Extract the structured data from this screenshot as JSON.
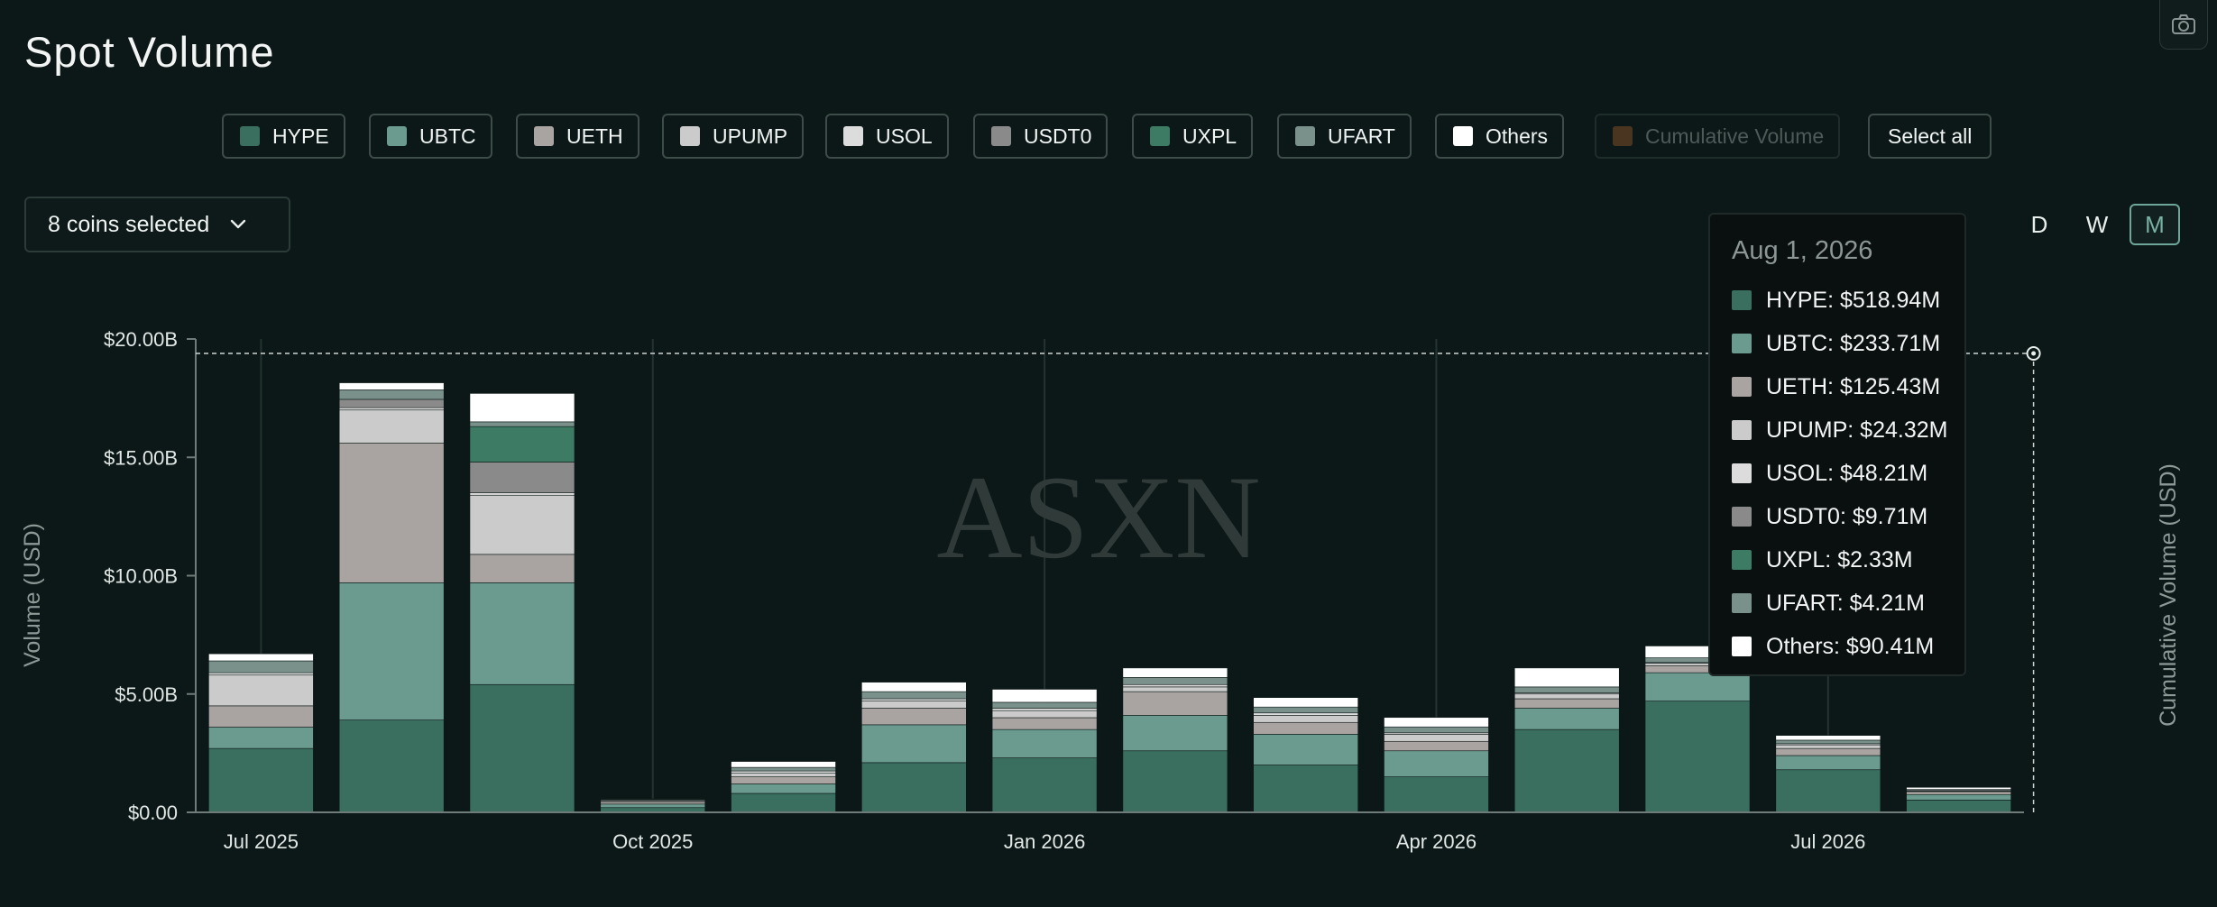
{
  "header": {
    "title": "Spot Volume"
  },
  "legend": [
    {
      "label": "HYPE",
      "color": "#3a6e5f",
      "active": true
    },
    {
      "label": "UBTC",
      "color": "#6b9a8f",
      "active": true
    },
    {
      "label": "UETH",
      "color": "#a9a3a1",
      "active": true
    },
    {
      "label": "UPUMP",
      "color": "#cbcbcb",
      "active": true
    },
    {
      "label": "USOL",
      "color": "#dcdcdc",
      "active": true
    },
    {
      "label": "USDT0",
      "color": "#8a8a8a",
      "active": true
    },
    {
      "label": "UXPL",
      "color": "#3e7b64",
      "active": true
    },
    {
      "label": "UFART",
      "color": "#7a918b",
      "active": true
    },
    {
      "label": "Others",
      "color": "#ffffff",
      "active": true
    },
    {
      "label": "Cumulative Volume",
      "color": "#5c4128",
      "active": false
    }
  ],
  "controls": {
    "select_all": "Select all",
    "coins_selected": "8 coins selected",
    "periods": [
      "D",
      "W",
      "M"
    ],
    "active_period": "M"
  },
  "watermark": "ASXN",
  "tooltip": {
    "date": "Aug 1, 2026",
    "rows": [
      {
        "label": "HYPE: $518.94M",
        "color": "#3a6e5f"
      },
      {
        "label": "UBTC: $233.71M",
        "color": "#6b9a8f"
      },
      {
        "label": "UETH: $125.43M",
        "color": "#a9a3a1"
      },
      {
        "label": "UPUMP: $24.32M",
        "color": "#cbcbcb"
      },
      {
        "label": "USOL: $48.21M",
        "color": "#dcdcdc"
      },
      {
        "label": "USDT0: $9.71M",
        "color": "#8a8a8a"
      },
      {
        "label": "UXPL: $2.33M",
        "color": "#3e7b64"
      },
      {
        "label": "UFART: $4.21M",
        "color": "#7a918b"
      },
      {
        "label": "Others: $90.41M",
        "color": "#ffffff"
      }
    ]
  },
  "chart_data": {
    "type": "bar",
    "stacked": true,
    "ylabel": "Volume (USD)",
    "y2label": "Cumulative Volume (USD)",
    "ylim": [
      0,
      20000000000
    ],
    "yticks": [
      "$0.00",
      "$5.00B",
      "$10.00B",
      "$15.00B",
      "$20.00B"
    ],
    "yticks_values": [
      0,
      5000000000,
      10000000000,
      15000000000,
      20000000000
    ],
    "categories": [
      "2025-07",
      "2025-08",
      "2025-09",
      "2025-10",
      "2025-11",
      "2025-12",
      "2026-01",
      "2026-02",
      "2026-03",
      "2026-04",
      "2026-05",
      "2026-06",
      "2026-07",
      "2026-08"
    ],
    "xticks": [
      {
        "label": "Jul 2025",
        "index": 0
      },
      {
        "label": "Oct 2025",
        "index": 3
      },
      {
        "label": "Jan 2026",
        "index": 6
      },
      {
        "label": "Apr 2026",
        "index": 9
      },
      {
        "label": "Jul 2026",
        "index": 12
      }
    ],
    "series": [
      {
        "name": "HYPE",
        "color": "#3a6e5f",
        "values": [
          2700000000,
          3900000000,
          5400000000,
          200000000,
          800000000,
          2100000000,
          2300000000,
          2600000000,
          2000000000,
          1500000000,
          3500000000,
          4700000000,
          1800000000,
          518940000
        ]
      },
      {
        "name": "UBTC",
        "color": "#6b9a8f",
        "values": [
          900000000,
          5800000000,
          4300000000,
          150000000,
          400000000,
          1600000000,
          1200000000,
          1500000000,
          1300000000,
          1100000000,
          900000000,
          1200000000,
          600000000,
          233710000
        ]
      },
      {
        "name": "UETH",
        "color": "#a9a3a1",
        "values": [
          900000000,
          5900000000,
          1200000000,
          100000000,
          300000000,
          700000000,
          500000000,
          1000000000,
          500000000,
          400000000,
          400000000,
          300000000,
          300000000,
          125430000
        ]
      },
      {
        "name": "UPUMP",
        "color": "#cbcbcb",
        "values": [
          1300000000,
          1400000000,
          2500000000,
          40000000,
          150000000,
          300000000,
          300000000,
          200000000,
          300000000,
          300000000,
          200000000,
          100000000,
          150000000,
          24320000
        ]
      },
      {
        "name": "USOL",
        "color": "#dcdcdc",
        "values": [
          100000000,
          100000000,
          100000000,
          20000000,
          100000000,
          100000000,
          100000000,
          100000000,
          100000000,
          60000000,
          50000000,
          30000000,
          50000000,
          48210000
        ]
      },
      {
        "name": "USDT0",
        "color": "#8a8a8a",
        "values": [
          0,
          350000000,
          1300000000,
          0,
          0,
          0,
          0,
          0,
          0,
          0,
          0,
          0,
          0,
          9710000
        ]
      },
      {
        "name": "UXPL",
        "color": "#3e7b64",
        "values": [
          0,
          0,
          1500000000,
          0,
          0,
          0,
          0,
          0,
          0,
          0,
          0,
          0,
          0,
          2330000
        ]
      },
      {
        "name": "UFART",
        "color": "#7a918b",
        "values": [
          500000000,
          400000000,
          200000000,
          40000000,
          150000000,
          300000000,
          250000000,
          300000000,
          250000000,
          250000000,
          250000000,
          200000000,
          150000000,
          4210000
        ]
      },
      {
        "name": "Others",
        "color": "#ffffff",
        "values": [
          300000000,
          300000000,
          1200000000,
          20000000,
          250000000,
          400000000,
          550000000,
          400000000,
          400000000,
          400000000,
          800000000,
          500000000,
          200000000,
          90410000
        ]
      }
    ],
    "hover": {
      "index": 13,
      "value": 20000000000
    }
  }
}
